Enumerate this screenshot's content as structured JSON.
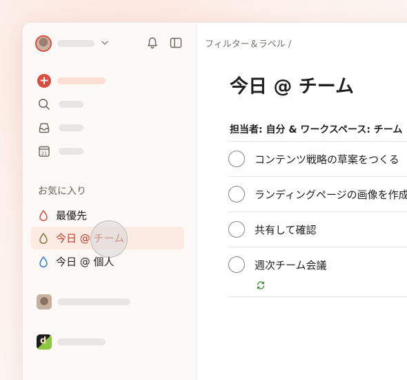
{
  "breadcrumb": "フィルター＆ラベル /",
  "page_title": "今日 @ チーム",
  "favorites_label": "お気に入り",
  "favorites": [
    {
      "label": "最優先",
      "color": "#dc4c3e"
    },
    {
      "label": "今日 @ チーム",
      "color": "#7a7a3a"
    },
    {
      "label": "今日 @ 個人",
      "color": "#2b7bd6"
    }
  ],
  "group_header": "担当者: 自分 & ワークスペース: チーム",
  "tasks": [
    {
      "text": "コンテンツ戦略の草案をつくる"
    },
    {
      "text": "ランディングページの画像を作成"
    },
    {
      "text": "共有して確認"
    },
    {
      "text": "週次チーム会議",
      "recurring": true
    }
  ],
  "icons": {
    "add": "plus-circle-icon",
    "search": "search-icon",
    "inbox": "inbox-icon",
    "today": "calendar-icon",
    "today_number": "21",
    "notifications": "bell-icon",
    "sidebar_toggle": "sidebar-toggle-icon",
    "recurring": "recurring-icon"
  },
  "colors": {
    "accent": "#dc4c3e",
    "active_bg": "#fcebe3",
    "recurring": "#3a8a3a"
  }
}
